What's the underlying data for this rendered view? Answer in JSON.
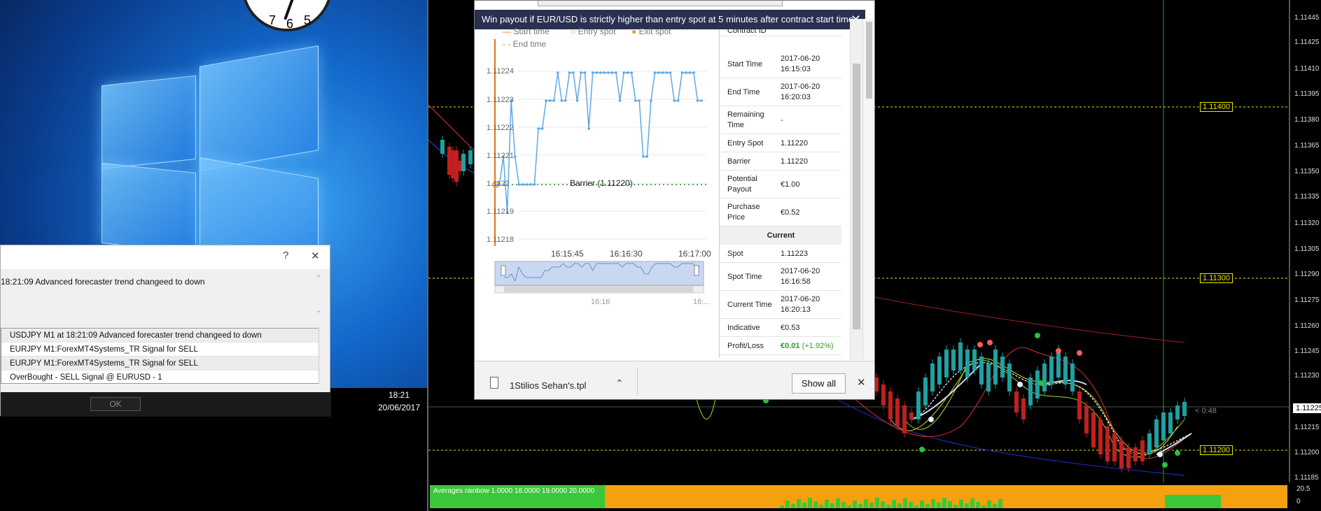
{
  "desktop": {
    "clock_numbers": [
      "7",
      "6",
      "5"
    ],
    "tray_time": "18:21",
    "tray_date": "20/06/2017"
  },
  "alert_dialog": {
    "help_btn": "?",
    "close_btn": "✕",
    "message": "18:21:09 Advanced forecaster trend changeed to down",
    "list": [
      "USDJPY M1 at 18:21:09 Advanced forecaster trend changeed to down",
      "EURJPY M1:ForexMT4Systems_TR Signal for SELL",
      "EURJPY M1:ForexMT4Systems_TR Signal for SELL",
      "OverBought - SELL Signal @ EURUSD - 1"
    ],
    "ok_label": "OK"
  },
  "trading_chart": {
    "price_labels": [
      "1.11445",
      "1.11425",
      "1.11410",
      "1.11395",
      "1.11380",
      "1.11365",
      "1.11350",
      "1.11335",
      "1.11320",
      "1.11305",
      "1.11290",
      "1.11275",
      "1.11260",
      "1.11245",
      "1.11230",
      "1.11225",
      "1.11215",
      "1.11200",
      "1.11185"
    ],
    "levels": [
      "1.11400",
      "1.11300",
      "1.11200"
    ],
    "current_price": "1.11225",
    "countdown": "< 0:48",
    "indicator_title": "Averages rainbow 1.0000 18.0000 19.0000 20.0000",
    "indicator_scale_top": "20.5",
    "indicator_scale_bottom": "0",
    "colors": {
      "background": "#000000",
      "bull": "#20a0a0",
      "bear": "#c02020",
      "level": "#e8e800",
      "indicator": "#f5a00e",
      "indicator_green": "#3ac83a"
    }
  },
  "contract_popup": {
    "banner": "Win payout if EUR/USD is strictly higher than entry spot at 5 minutes after contract start time.",
    "banner_close": "✕",
    "legend": {
      "start": "Start time",
      "entry": "Entry spot",
      "exit": "Exit spot",
      "end": "End time"
    },
    "y_ticks": [
      "1.11224",
      "1.11223",
      "1.11222",
      "1.11221",
      "1.1122",
      "1.11219",
      "1.11218"
    ],
    "x_ticks": [
      "16:15:45",
      "16:16:30",
      "16:17:00"
    ],
    "barrier_label": "Barrier (1.11220)",
    "navigator_labels": [
      "16:16",
      "16:..."
    ],
    "info": {
      "contract_id_label": "Contract ID",
      "start_time_label": "Start Time",
      "start_time": "2017-06-20\n16:15:03",
      "end_time_label": "End Time",
      "end_time": "2017-06-20\n16:20:03",
      "remaining_label": "Remaining\nTime",
      "remaining": "-",
      "entry_spot_label": "Entry Spot",
      "entry_spot": "1.11220",
      "barrier_label": "Barrier",
      "barrier": "1.11220",
      "payout_label": "Potential\nPayout",
      "payout": "€1.00",
      "purchase_label": "Purchase\nPrice",
      "purchase": "€0.52",
      "current_section": "Current",
      "spot_label": "Spot",
      "spot": "1.11223",
      "spot_time_label": "Spot Time",
      "spot_time": "2017-06-20\n16:16:58",
      "current_time_label": "Current Time",
      "current_time": "2017-06-20\n16:20:13",
      "indicative_label": "Indicative",
      "indicative": "€0.53",
      "pl_label": "Profit/Loss",
      "pl": "€0.01",
      "pl_pct": "(+1.92%)"
    },
    "chart_colors": {
      "line": "#5ea8e8",
      "barrier": "#1a8a1a",
      "start": "#e8741a",
      "entry": "#f0a020"
    }
  },
  "downloads": {
    "file": "1Stilios Sehan's.tpl",
    "chevron": "⌃",
    "show_all": "Show all",
    "close": "✕"
  }
}
